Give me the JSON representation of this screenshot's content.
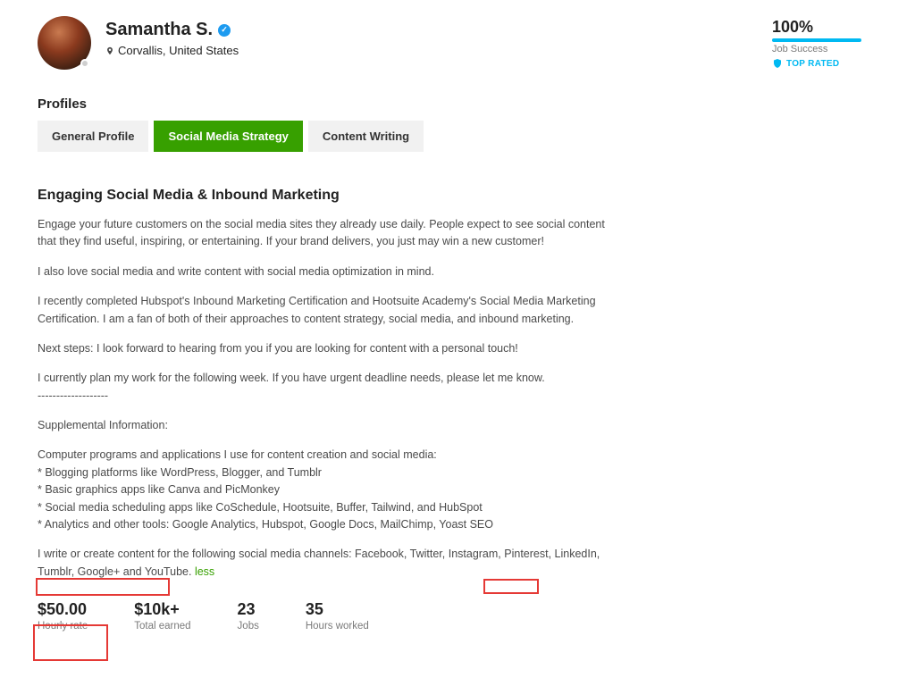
{
  "profile": {
    "name": "Samantha S.",
    "location": "Corvallis, United States"
  },
  "job_success": {
    "pct": "100%",
    "label": "Job Success",
    "top_rated": "TOP RATED"
  },
  "profiles_heading": "Profiles",
  "tabs": [
    {
      "label": "General Profile",
      "active": false
    },
    {
      "label": "Social Media Strategy",
      "active": true
    },
    {
      "label": "Content Writing",
      "active": false
    }
  ],
  "section": {
    "title": "Engaging Social Media & Inbound Marketing",
    "paras": [
      "Engage your future customers on the social media sites they already use daily. People expect to see social content that they find useful, inspiring, or entertaining. If your brand delivers, you just may win a new customer!",
      "I also love social media and write content with social media optimization in mind.",
      "I recently completed Hubspot's Inbound Marketing Certification and Hootsuite Academy's Social Media Marketing Certification. I am a fan of both of their approaches to content strategy, social media, and inbound marketing.",
      "Next steps: I look forward to hearing from you if you are looking for content with a personal touch!",
      "I currently plan my work for the following week. If you have urgent deadline needs, please let me know.\n-------------------",
      "Supplemental Information:",
      "Computer programs and applications I use for content creation and social media:\n* Blogging platforms like WordPress, Blogger, and Tumblr\n* Basic graphics apps like Canva and PicMonkey\n* Social media scheduling apps like CoSchedule, Hootsuite, Buffer, Tailwind, and HubSpot\n* Analytics and other tools: Google Analytics, Hubspot, Google Docs, MailChimp, Yoast SEO"
    ],
    "last_para_pre": "I write or create content for the following social media channels: Facebook, Twitter, Instagram, Pinterest, LinkedIn, Tumblr, Google+ and YouTube. ",
    "less": "less"
  },
  "stats": [
    {
      "value": "$50.00",
      "label": "Hourly rate"
    },
    {
      "value": "$10k+",
      "label": "Total earned"
    },
    {
      "value": "23",
      "label": "Jobs"
    },
    {
      "value": "35",
      "label": "Hours worked"
    }
  ]
}
